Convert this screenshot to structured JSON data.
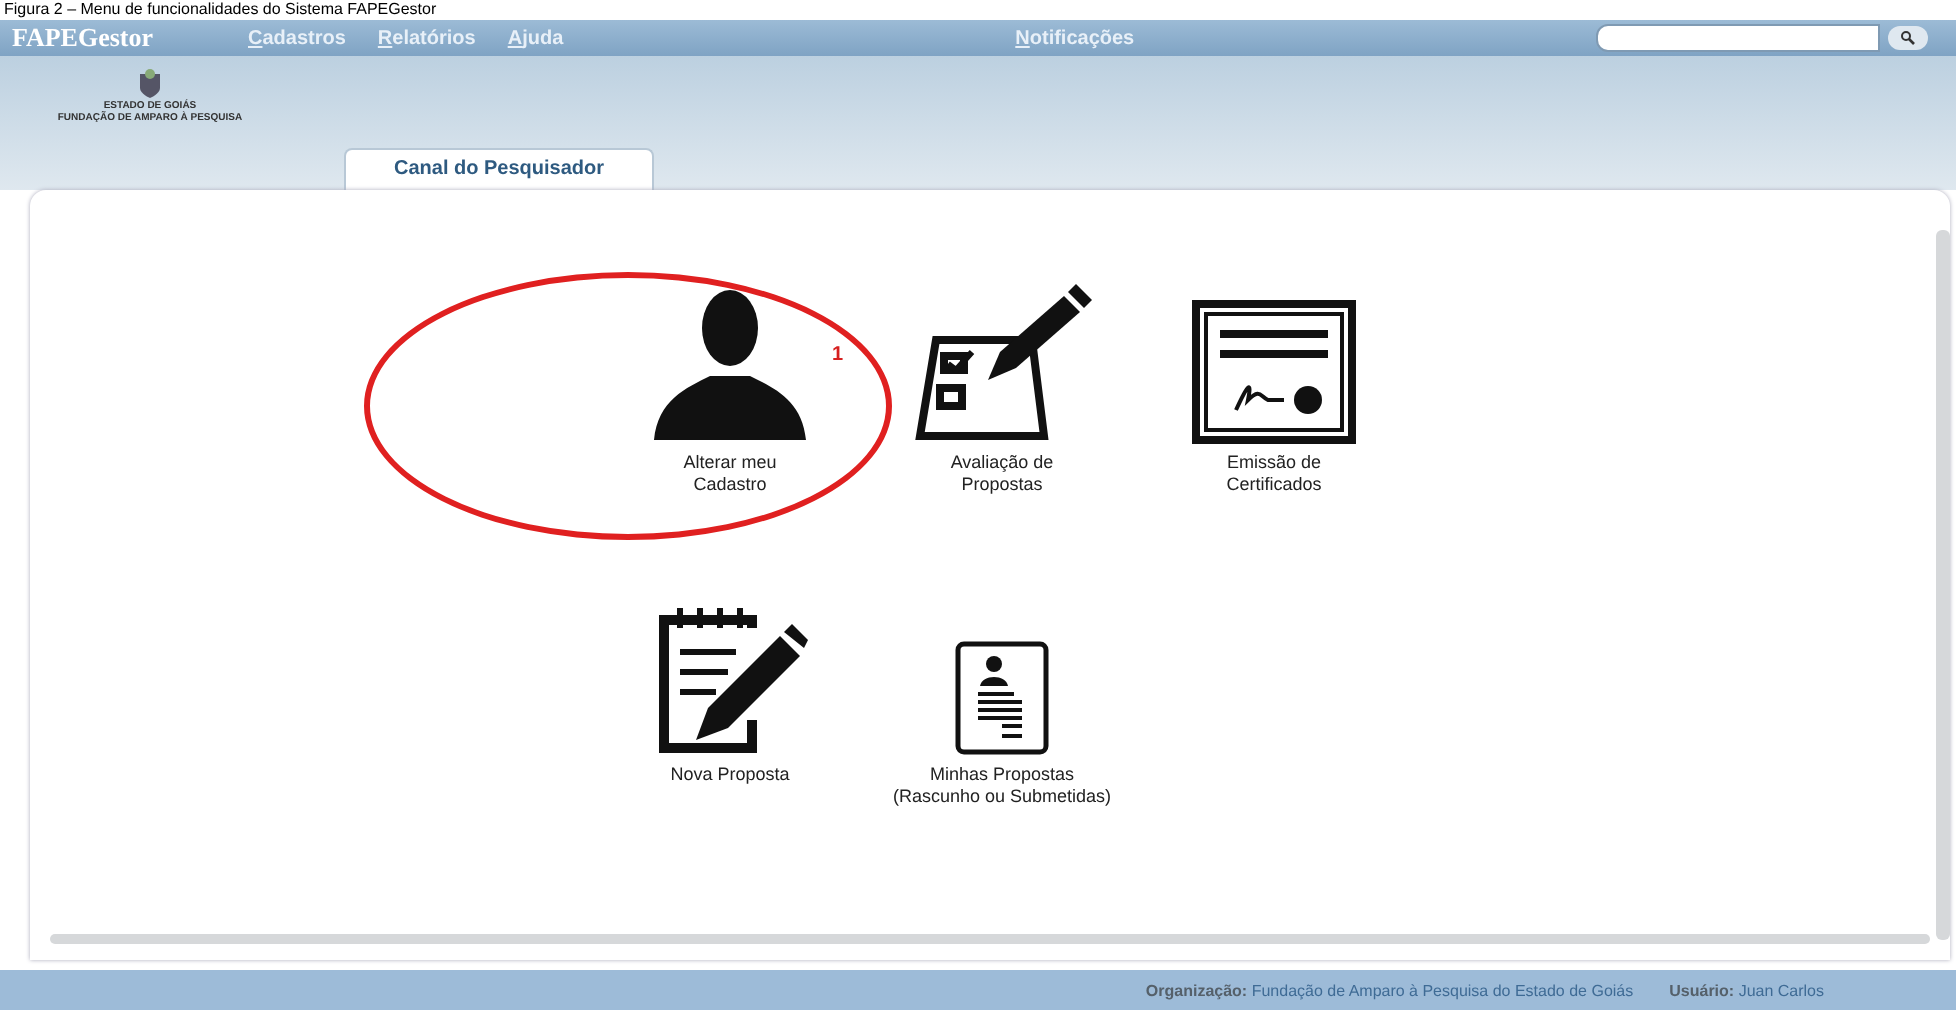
{
  "caption": "Figura 2 – Menu de funcionalidades do Sistema FAPEGestor",
  "menu_bar": {
    "brand": "FAPEGestor",
    "items": [
      "Cadastros",
      "Relatórios",
      "Ajuda"
    ],
    "notifications": "Notificações"
  },
  "org_logo": {
    "line_1": "ESTADO DE GOIÁS",
    "line_2": "FUNDAÇÃO DE AMPARO À PESQUISA"
  },
  "tabs": [
    {
      "label": "Canal do Pesquisador",
      "selected": true
    }
  ],
  "rows": [
    [
      {
        "kind": "person",
        "label": "Alterar meu\nCadastro"
      },
      {
        "kind": "checklist",
        "label": "Avaliação de\nPropostas"
      },
      {
        "kind": "certificate",
        "label": "Emissão de\nCertificados"
      }
    ],
    [
      {
        "kind": "notepad",
        "label": "Nova Proposta"
      },
      {
        "kind": "document",
        "label": "Minhas Propostas\n(Rascunho ou Submetidas)"
      }
    ]
  ],
  "annotation": {
    "number": "1"
  },
  "status_bar": {
    "organization_label": "Organização:",
    "organization": "Fundação de Amparo à  Pesquisa do Estado de Goiás",
    "user_label": "Usuário:",
    "user": "Juan Carlos"
  }
}
